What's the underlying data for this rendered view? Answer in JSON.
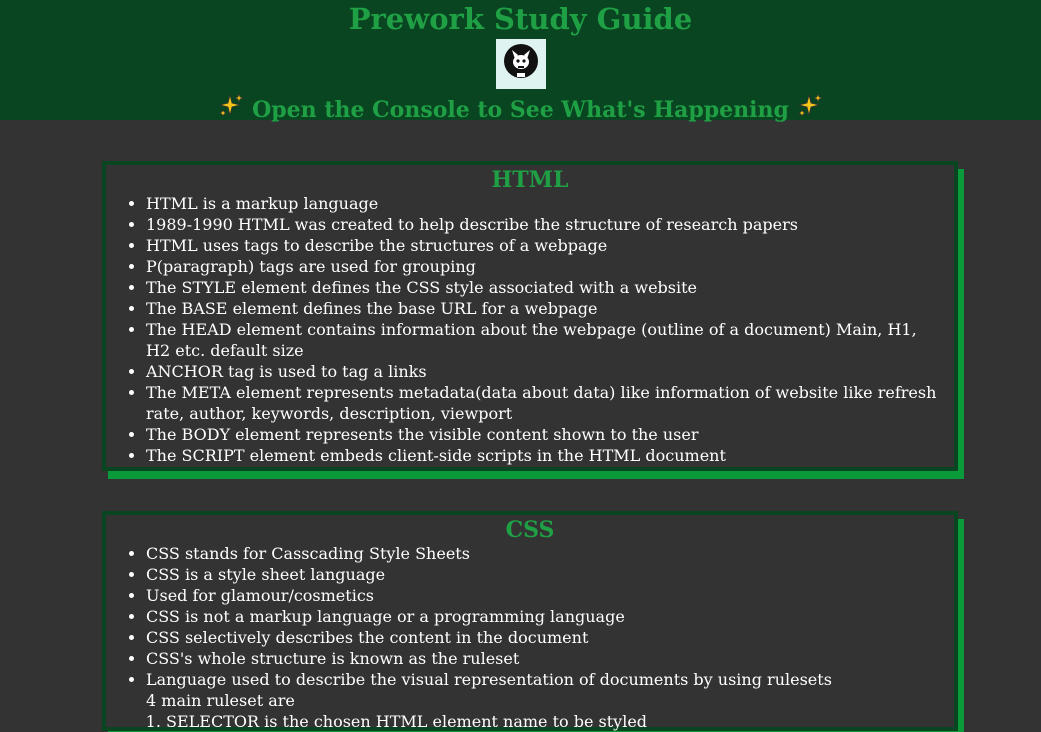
{
  "header": {
    "title": "Prework Study Guide",
    "tagline": "Open the Console to See What's Happening"
  },
  "sections": {
    "html": {
      "heading": "HTML",
      "items": [
        "HTML is a markup language",
        "1989-1990 HTML was created to help describe the structure of research papers",
        "HTML uses tags to describe the structures of a webpage",
        "P(paragraph) tags are used for grouping",
        "The STYLE element defines the CSS style associated with a website",
        "The BASE element defines the base URL for a webpage",
        "The HEAD element contains information about the webpage (outline of a document) Main, H1, H2 etc. default size",
        "ANCHOR tag is used to tag a links",
        "The META element represents metadata(data about data) like information of website like refresh rate, author, keywords, description, viewport",
        "The BODY element represents the visible content shown to the user",
        "The SCRIPT element embeds client-side scripts in the HTML document"
      ]
    },
    "css": {
      "heading": "CSS",
      "items": [
        "CSS stands for Casscading Style Sheets",
        "CSS is a style sheet language",
        "Used for glamour/cosmetics",
        "CSS is not a markup language or a programming language",
        "CSS selectively describes the content in the document",
        "CSS's whole structure is known as the ruleset",
        "Language used to describe the visual representation of documents by using rulesets"
      ],
      "ruleset_intro": "4 main ruleset are",
      "ruleset_items": [
        "SELECTOR is the chosen HTML element name to be styled"
      ]
    }
  },
  "colors": {
    "header_bg": "#0a4521",
    "page_bg": "#333333",
    "accent_green": "#1fa045",
    "card_shadow": "#0a9a3a"
  },
  "icons": [
    "cat-avatar-icon",
    "sparkles-icon"
  ]
}
